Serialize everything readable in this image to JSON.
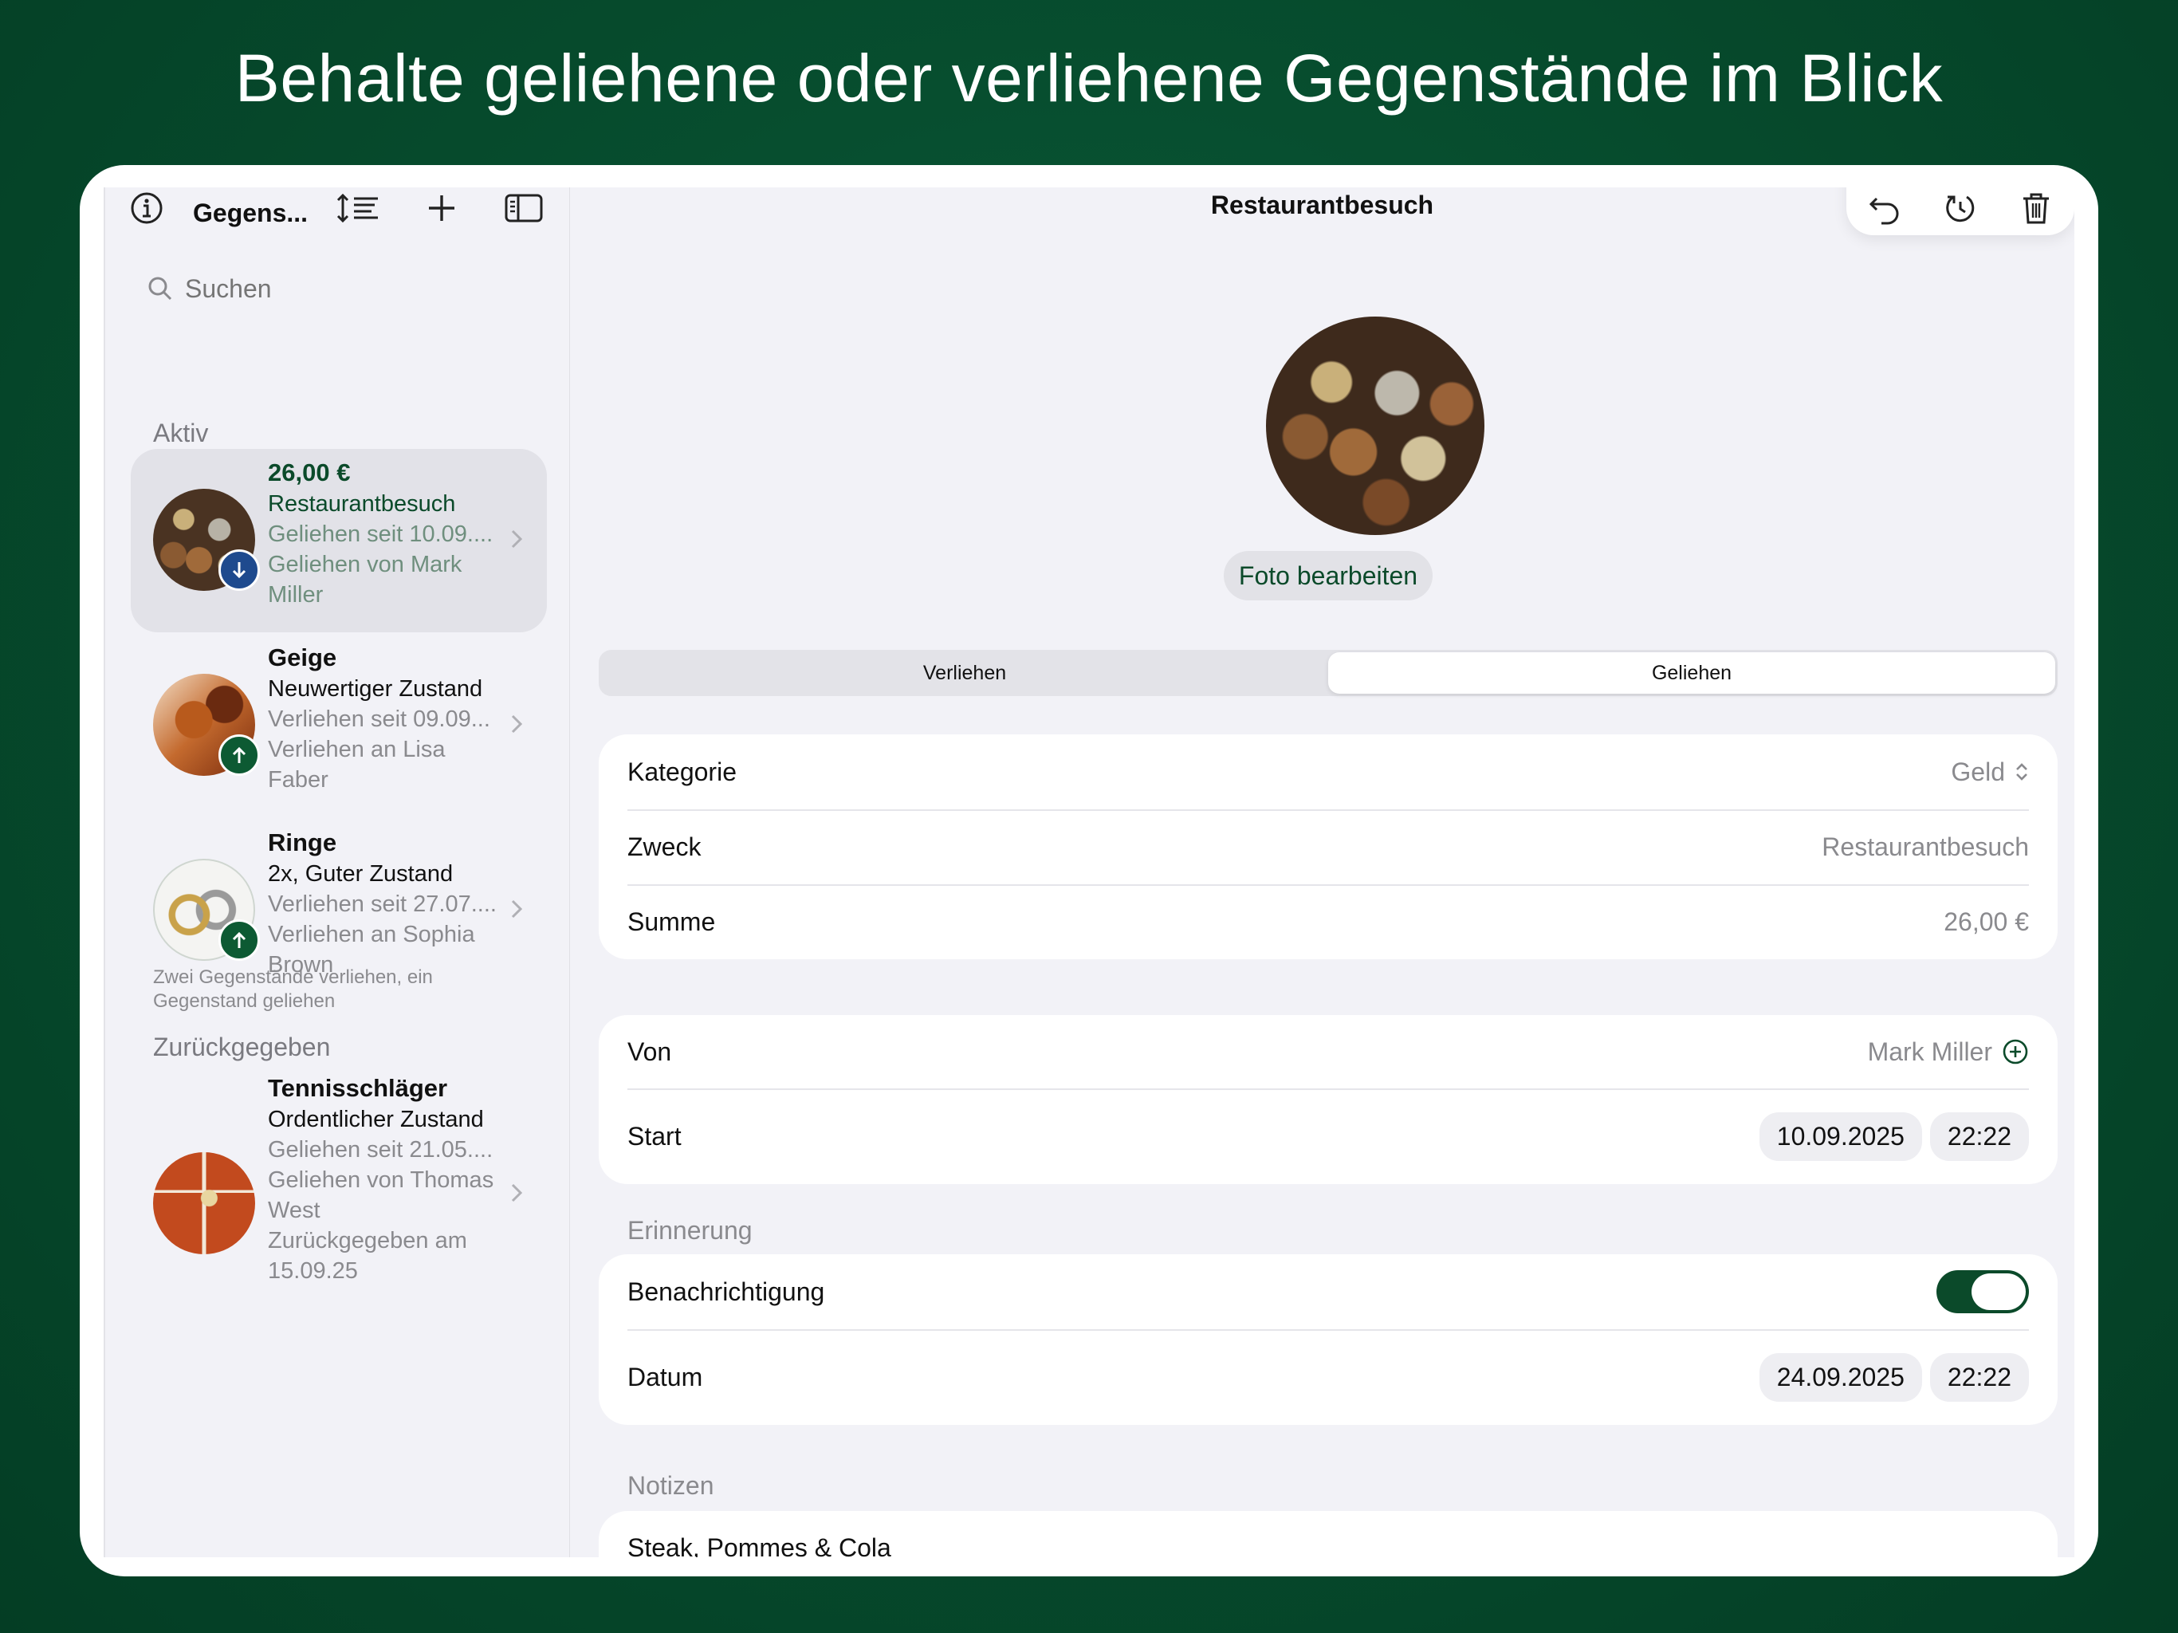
{
  "headline": "Behalte geliehene oder verliehene Gegenstände im Blick",
  "sidebar": {
    "title": "Gegens...",
    "search_placeholder": "Suchen",
    "section_active": "Aktiv",
    "section_returned": "Zurückgegeben",
    "footnote": "Zwei Gegenstände verliehen, ein Gegenstand geliehen",
    "items": [
      {
        "title": "26,00 €",
        "subtitle": "Restaurantbesuch",
        "line1": "Geliehen seit 10.09....",
        "line2": "Geliehen von Mark",
        "line3": "Miller",
        "direction": "down",
        "thumb": "coins"
      },
      {
        "title": "Geige",
        "subtitle": "Neuwertiger Zustand",
        "line1": "Verliehen seit 09.09...",
        "line2": "Verliehen an Lisa",
        "line3": "Faber",
        "direction": "up",
        "thumb": "violin"
      },
      {
        "title": "Ringe",
        "subtitle": "2x, Guter Zustand",
        "line1": "Verliehen seit 27.07....",
        "line2": "Verliehen an Sophia",
        "line3": "Brown",
        "direction": "up",
        "thumb": "rings"
      }
    ],
    "returned_items": [
      {
        "title": "Tennisschläger",
        "subtitle": "Ordentlicher Zustand",
        "line1": "Geliehen seit 21.05....",
        "line2": "Geliehen von Thomas",
        "line3": "West",
        "line4": "Zurückgegeben am",
        "line5": "15.09.25",
        "thumb": "tennis"
      }
    ]
  },
  "detail": {
    "title": "Restaurantbesuch",
    "photo_button": "Foto bearbeiten",
    "segments": [
      "Verliehen",
      "Geliehen"
    ],
    "selected_segment": "Geliehen",
    "fields": {
      "category_label": "Kategorie",
      "category_value": "Geld",
      "purpose_label": "Zweck",
      "purpose_value": "Restaurantbesuch",
      "sum_label": "Summe",
      "sum_value": "26,00 €"
    },
    "person": {
      "from_label": "Von",
      "from_value": "Mark Miller",
      "start_label": "Start",
      "start_date": "10.09.2025",
      "start_time": "22:22"
    },
    "reminder": {
      "section": "Erinnerung",
      "notify_label": "Benachrichtigung",
      "notify_on": true,
      "date_label": "Datum",
      "date": "24.09.2025",
      "time": "22:22"
    },
    "notes": {
      "section": "Notizen",
      "text": "Steak, Pommes & Cola"
    }
  },
  "colors": {
    "accent": "#0b4a2a",
    "background": "#064a2c",
    "badge_down": "#1e4a8e",
    "badge_up": "#0d5a33"
  }
}
